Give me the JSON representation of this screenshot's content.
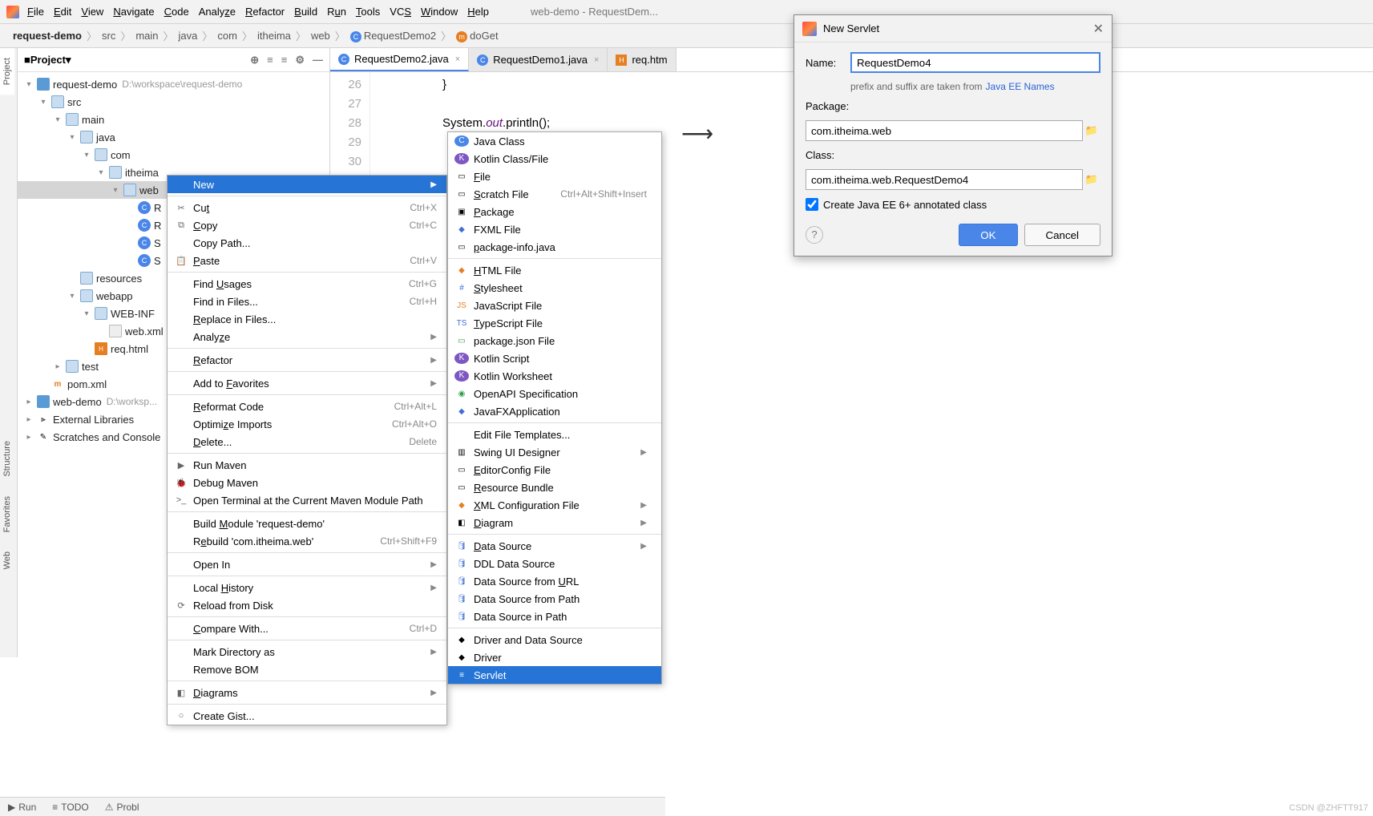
{
  "menubar": {
    "items": [
      "File",
      "Edit",
      "View",
      "Navigate",
      "Code",
      "Analyze",
      "Refactor",
      "Build",
      "Run",
      "Tools",
      "VCS",
      "Window",
      "Help"
    ],
    "winlabel": "web-demo - RequestDem..."
  },
  "breadcrumb": {
    "items": [
      "request-demo",
      "src",
      "main",
      "java",
      "com",
      "itheima",
      "web",
      "RequestDemo2",
      "doGet"
    ]
  },
  "project": {
    "title": "Project",
    "rows": [
      {
        "indent": 0,
        "chev": "▾",
        "icon": "module",
        "label": "request-demo",
        "path": "D:\\workspace\\request-demo"
      },
      {
        "indent": 1,
        "chev": "▾",
        "icon": "folder",
        "label": "src"
      },
      {
        "indent": 2,
        "chev": "▾",
        "icon": "folder",
        "label": "main"
      },
      {
        "indent": 3,
        "chev": "▾",
        "icon": "folder",
        "label": "java"
      },
      {
        "indent": 4,
        "chev": "▾",
        "icon": "folder",
        "label": "com"
      },
      {
        "indent": 5,
        "chev": "▾",
        "icon": "folder",
        "label": "itheima"
      },
      {
        "indent": 6,
        "chev": "▾",
        "icon": "folder",
        "label": "web",
        "selected": true
      },
      {
        "indent": 7,
        "chev": "",
        "icon": "cls",
        "label": "R"
      },
      {
        "indent": 7,
        "chev": "",
        "icon": "cls",
        "label": "R"
      },
      {
        "indent": 7,
        "chev": "",
        "icon": "cls",
        "label": "S"
      },
      {
        "indent": 7,
        "chev": "",
        "icon": "cls",
        "label": "S"
      },
      {
        "indent": 3,
        "chev": "",
        "icon": "folder",
        "label": "resources"
      },
      {
        "indent": 3,
        "chev": "▾",
        "icon": "folder",
        "label": "webapp"
      },
      {
        "indent": 4,
        "chev": "▾",
        "icon": "folder",
        "label": "WEB-INF"
      },
      {
        "indent": 5,
        "chev": "",
        "icon": "file",
        "label": "web.xml"
      },
      {
        "indent": 4,
        "chev": "",
        "icon": "html",
        "label": "req.html"
      },
      {
        "indent": 2,
        "chev": "▸",
        "icon": "folder",
        "label": "test"
      },
      {
        "indent": 1,
        "chev": "",
        "icon": "pom",
        "label": "pom.xml"
      },
      {
        "indent": 0,
        "chev": "▸",
        "icon": "module",
        "label": "web-demo",
        "path": "D:\\worksp..."
      },
      {
        "indent": 0,
        "chev": "▸",
        "icon": "lib",
        "label": "External Libraries"
      },
      {
        "indent": 0,
        "chev": "▸",
        "icon": "scratch",
        "label": "Scratches and Console"
      }
    ]
  },
  "tabs": [
    {
      "label": "RequestDemo2.java",
      "icon": "cls",
      "active": true
    },
    {
      "label": "RequestDemo1.java",
      "icon": "cls"
    },
    {
      "label": "req.htm",
      "icon": "html"
    }
  ],
  "code": {
    "lines": [
      {
        "n": "26",
        "text": "        }"
      },
      {
        "n": "27",
        "text": ""
      },
      {
        "n": "28",
        "text": "        System.out.println();"
      },
      {
        "n": "29",
        "text": ""
      },
      {
        "n": "30",
        "text": ""
      }
    ]
  },
  "ctxmenu": {
    "items": [
      {
        "label": "New",
        "sel": true,
        "arrow": true
      },
      {
        "sep": true
      },
      {
        "label": "Cut",
        "icon": "✂",
        "hint": "Ctrl+X",
        "u": "t"
      },
      {
        "label": "Copy",
        "icon": "⧉",
        "hint": "Ctrl+C",
        "u": "C"
      },
      {
        "label": "Copy Path..."
      },
      {
        "label": "Paste",
        "icon": "📋",
        "hint": "Ctrl+V",
        "u": "P"
      },
      {
        "sep": true
      },
      {
        "label": "Find Usages",
        "hint": "Ctrl+G",
        "u": "U"
      },
      {
        "label": "Find in Files...",
        "hint": "Ctrl+H"
      },
      {
        "label": "Replace in Files...",
        "u": "R"
      },
      {
        "label": "Analyze",
        "arrow": true,
        "u": "z"
      },
      {
        "sep": true
      },
      {
        "label": "Refactor",
        "arrow": true,
        "u": "R"
      },
      {
        "sep": true
      },
      {
        "label": "Add to Favorites",
        "arrow": true,
        "u": "F"
      },
      {
        "sep": true
      },
      {
        "label": "Reformat Code",
        "hint": "Ctrl+Alt+L",
        "u": "R"
      },
      {
        "label": "Optimize Imports",
        "hint": "Ctrl+Alt+O",
        "u": "z"
      },
      {
        "label": "Delete...",
        "hint": "Delete",
        "u": "D"
      },
      {
        "sep": true
      },
      {
        "label": "Run Maven",
        "icon": "▶"
      },
      {
        "label": "Debug Maven",
        "icon": "🐞"
      },
      {
        "label": "Open Terminal at the Current Maven Module Path",
        "icon": ">_"
      },
      {
        "sep": true
      },
      {
        "label": "Build Module 'request-demo'",
        "u": "M"
      },
      {
        "label": "Rebuild 'com.itheima.web'",
        "hint": "Ctrl+Shift+F9",
        "u": "e"
      },
      {
        "sep": true
      },
      {
        "label": "Open In",
        "arrow": true
      },
      {
        "sep": true
      },
      {
        "label": "Local History",
        "arrow": true,
        "u": "H"
      },
      {
        "label": "Reload from Disk",
        "icon": "⟳"
      },
      {
        "sep": true
      },
      {
        "label": "Compare With...",
        "hint": "Ctrl+D",
        "u": "C"
      },
      {
        "sep": true
      },
      {
        "label": "Mark Directory as",
        "arrow": true
      },
      {
        "label": "Remove BOM"
      },
      {
        "sep": true
      },
      {
        "label": "Diagrams",
        "icon": "◧",
        "arrow": true,
        "u": "D"
      },
      {
        "sep": true
      },
      {
        "label": "Create Gist...",
        "icon": "○"
      }
    ]
  },
  "submenu": {
    "items": [
      {
        "label": "Java Class",
        "icon": "C",
        "cls": "ico-cc"
      },
      {
        "label": "Kotlin Class/File",
        "icon": "K",
        "cls": "ico-k"
      },
      {
        "label": "File",
        "icon": "▭",
        "u": "F"
      },
      {
        "label": "Scratch File",
        "icon": "▭",
        "hint": "Ctrl+Alt+Shift+Insert",
        "u": "S"
      },
      {
        "label": "Package",
        "icon": "▣",
        "u": "P"
      },
      {
        "label": "FXML File",
        "icon": "◆",
        "cls": "ico-blue"
      },
      {
        "label": "package-info.java",
        "icon": "▭",
        "u": "p"
      },
      {
        "sep": true
      },
      {
        "label": "HTML File",
        "icon": "◆",
        "cls": "ico-orange",
        "u": "H"
      },
      {
        "label": "Stylesheet",
        "icon": "#",
        "cls": "ico-blue",
        "u": "S"
      },
      {
        "label": "JavaScript File",
        "icon": "JS",
        "cls": "ico-orange"
      },
      {
        "label": "TypeScript File",
        "icon": "TS",
        "cls": "ico-blue",
        "u": "T"
      },
      {
        "label": "package.json File",
        "icon": "▭",
        "cls": "ico-green"
      },
      {
        "label": "Kotlin Script",
        "icon": "K",
        "cls": "ico-k"
      },
      {
        "label": "Kotlin Worksheet",
        "icon": "K",
        "cls": "ico-k"
      },
      {
        "label": "OpenAPI Specification",
        "icon": "◉",
        "cls": "ico-green"
      },
      {
        "label": "JavaFXApplication",
        "icon": "◆",
        "cls": "ico-blue"
      },
      {
        "sep": true
      },
      {
        "label": "Edit File Templates..."
      },
      {
        "label": "Swing UI Designer",
        "icon": "▥",
        "arrow": true
      },
      {
        "label": "EditorConfig File",
        "icon": "▭",
        "u": "E"
      },
      {
        "label": "Resource Bundle",
        "icon": "▭",
        "u": "R"
      },
      {
        "label": "XML Configuration File",
        "icon": "◆",
        "cls": "ico-orange",
        "arrow": true,
        "u": "X"
      },
      {
        "label": "Diagram",
        "icon": "◧",
        "arrow": true,
        "u": "D"
      },
      {
        "sep": true
      },
      {
        "label": "Data Source",
        "icon": "🛢",
        "cls": "ico-blue",
        "arrow": true,
        "u": "D"
      },
      {
        "label": "DDL Data Source",
        "icon": "🛢",
        "cls": "ico-blue"
      },
      {
        "label": "Data Source from URL",
        "icon": "🛢",
        "cls": "ico-blue",
        "u": "U"
      },
      {
        "label": "Data Source from Path",
        "icon": "🛢",
        "cls": "ico-blue"
      },
      {
        "label": "Data Source in Path",
        "icon": "🛢",
        "cls": "ico-blue"
      },
      {
        "sep": true
      },
      {
        "label": "Driver and Data Source",
        "icon": "◆"
      },
      {
        "label": "Driver",
        "icon": "◆"
      },
      {
        "label": "Servlet",
        "icon": "≡",
        "sel": true
      }
    ]
  },
  "dialog": {
    "title": "New Servlet",
    "nameLabel": "Name:",
    "nameValue": "RequestDemo4",
    "hint": "prefix and suffix are taken from",
    "hintLink": "Java EE Names",
    "packageLabel": "Package:",
    "packageValue": "com.itheima.web",
    "classLabel": "Class:",
    "classValue": "com.itheima.web.RequestDemo4",
    "checkbox": "Create Java EE 6+ annotated class",
    "ok": "OK",
    "cancel": "Cancel"
  },
  "sidetabs": {
    "project": "Project",
    "favorites": "Favorites",
    "structure": "Structure",
    "web": "Web"
  },
  "bottombar": {
    "run": "Run",
    "todo": "TODO",
    "problems": "Probl"
  },
  "watermark": "CSDN @ZHFTT917"
}
